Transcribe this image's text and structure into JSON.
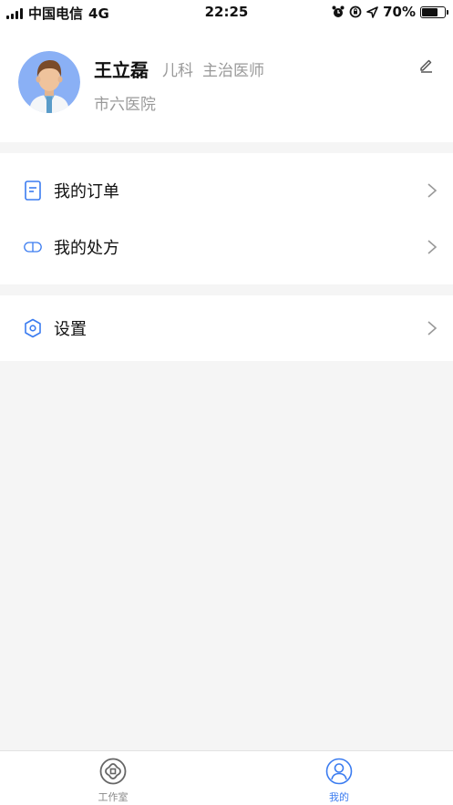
{
  "status_bar": {
    "carrier": "中国电信",
    "network": "4G",
    "time": "22:25",
    "battery_percent": "70%",
    "battery_level": 0.7
  },
  "profile": {
    "name": "王立磊",
    "department": "儿科",
    "title": "主治医师",
    "hospital": "市六医院",
    "avatar_icon": "doctor-avatar-icon",
    "edit_icon": "pencil-icon"
  },
  "menu_groups": [
    {
      "items": [
        {
          "label": "我的订单",
          "icon": "order-doc-icon"
        },
        {
          "label": "我的处方",
          "icon": "pill-capsule-icon"
        }
      ]
    },
    {
      "items": [
        {
          "label": "设置",
          "icon": "hexagon-settings-icon"
        }
      ]
    }
  ],
  "tab_bar": {
    "tabs": [
      {
        "label": "工作室",
        "icon": "studio-icon",
        "active": false
      },
      {
        "label": "我的",
        "icon": "user-circle-icon",
        "active": true
      }
    ]
  },
  "colors": {
    "accent": "#3b7cf0",
    "text_primary": "#111111",
    "text_secondary": "#999999",
    "background": "#f5f5f5",
    "tab_inactive": "#888888"
  }
}
